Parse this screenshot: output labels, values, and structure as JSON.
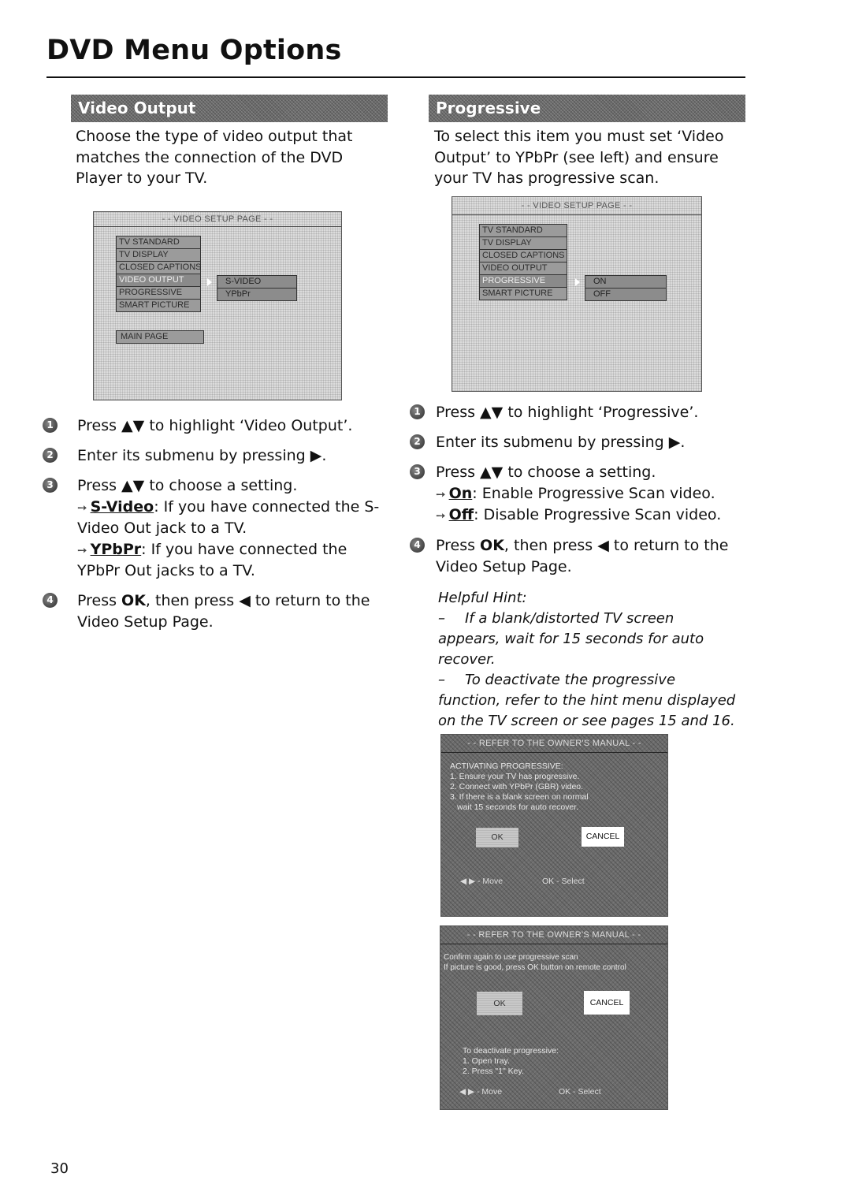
{
  "page": {
    "title": "DVD Menu Options",
    "page_number": "30"
  },
  "video_output": {
    "heading": "Video Output",
    "intro": "Choose the type of video output that matches the connection of the DVD Player to your TV.",
    "screen": {
      "header": "- - VIDEO SETUP PAGE - -",
      "menu_items": [
        "TV STANDARD",
        "TV DISPLAY",
        "CLOSED CAPTIONS",
        "VIDEO OUTPUT",
        "PROGRESSIVE",
        "SMART PICTURE"
      ],
      "active_item": "VIDEO OUTPUT",
      "submenu_items": [
        "S-VIDEO",
        "YPbPr"
      ],
      "main_page_label": "MAIN PAGE"
    },
    "steps": [
      {
        "num": "1",
        "pre": "Press ",
        "keys": "▲▼",
        "post": " to highlight ‘Video Output’."
      },
      {
        "num": "2",
        "pre": "Enter its submenu by pressing ",
        "keys": "▶",
        "post": "."
      },
      {
        "num": "3",
        "pre": "Press ",
        "keys": "▲▼",
        "post": " to choose a setting.",
        "options": [
          {
            "arrow": "➙",
            "name": "S-Video",
            "desc": ": If you have connected the S-Video Out jack to a TV."
          },
          {
            "arrow": "➙",
            "name": "YPbPr",
            "desc": ": If you have connected the YPbPr Out jacks to a TV."
          }
        ]
      },
      {
        "num": "4",
        "pre": "Press ",
        "bold": "OK",
        "mid": ", then press ",
        "keys": "◀",
        "post": " to return to the Video Setup Page."
      }
    ]
  },
  "progressive": {
    "heading": "Progressive",
    "intro": "To select this item you must set ‘Video Output’ to YPbPr (see left) and ensure your TV has progressive scan.",
    "screen": {
      "header": "- - VIDEO SETUP PAGE - -",
      "menu_items": [
        "TV STANDARD",
        "TV DISPLAY",
        "CLOSED CAPTIONS",
        "VIDEO OUTPUT",
        "PROGRESSIVE",
        "SMART PICTURE"
      ],
      "active_item": "PROGRESSIVE",
      "submenu_items": [
        "ON",
        "OFF"
      ]
    },
    "steps": [
      {
        "num": "1",
        "pre": "Press ",
        "keys": "▲▼",
        "post": " to highlight ‘Progressive’."
      },
      {
        "num": "2",
        "pre": "Enter its submenu by pressing ",
        "keys": "▶",
        "post": "."
      },
      {
        "num": "3",
        "pre": "Press ",
        "keys": "▲▼",
        "post": " to choose a setting.",
        "options": [
          {
            "arrow": "➙",
            "name": "On",
            "desc": ": Enable Progressive Scan video."
          },
          {
            "arrow": "➙",
            "name": "Off",
            "desc": ": Disable Progressive Scan video."
          }
        ]
      },
      {
        "num": "4",
        "pre": "Press ",
        "bold": "OK",
        "mid": ", then press ",
        "keys": "◀",
        "post": " to return to the Video Setup Page."
      }
    ],
    "hint": {
      "title": "Helpful Hint:",
      "items": [
        "If a blank/distorted TV screen appears, wait for 15 seconds for auto recover.",
        "To deactivate the progressive function, refer to the hint menu displayed on the TV screen or see pages 15 and 16."
      ]
    },
    "dialog1": {
      "header": "- - REFER TO THE OWNER'S MANUAL - -",
      "lines": [
        "ACTIVATING PROGRESSIVE:",
        "1. Ensure your TV has progressive.",
        "2. Connect with YPbPr (GBR) video.",
        "3. If there is a blank screen on normal",
        "   wait 15 seconds for auto recover."
      ],
      "ok_label": "OK",
      "cancel_label": "CANCEL",
      "footer_move": "◀ ▶ - Move",
      "footer_select": "OK - Select"
    },
    "dialog2": {
      "header": "- - REFER TO THE OWNER'S MANUAL - -",
      "lines": [
        "Confirm again to use progressive scan",
        "If picture is good, press OK button on remote control"
      ],
      "ok_label": "OK",
      "cancel_label": "CANCEL",
      "deactivate_lines": [
        "To deactivate progressive:",
        "1. Open tray.",
        "2. Press \"1\" Key."
      ],
      "footer_move": "◀ ▶ - Move",
      "footer_select": "OK - Select"
    }
  }
}
